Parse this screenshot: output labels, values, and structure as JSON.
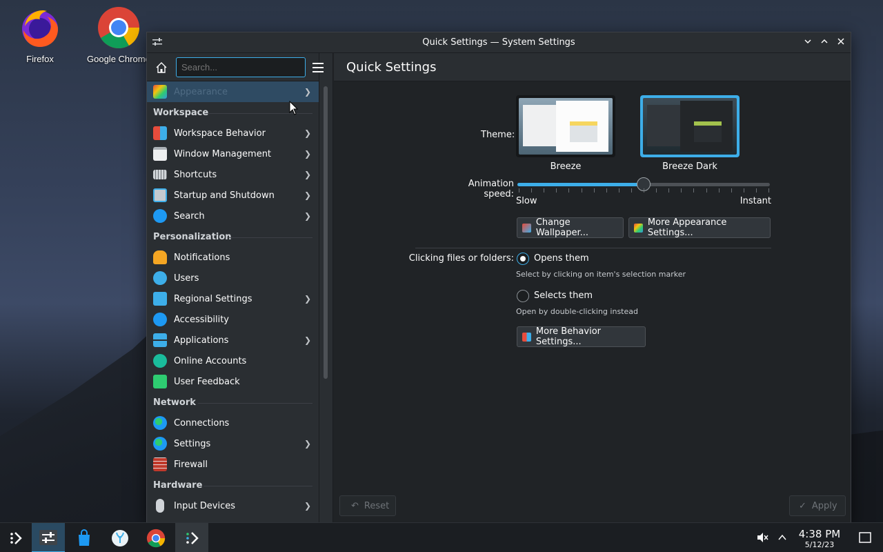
{
  "desktop": {
    "icons": [
      {
        "label": "Firefox"
      },
      {
        "label": "Google Chrome"
      }
    ]
  },
  "window": {
    "title": "Quick Settings — System Settings",
    "buttons": {
      "minimize": "⌄",
      "maximize": "⌃",
      "close": "✕"
    }
  },
  "sidebar": {
    "search_placeholder": "Search...",
    "selected_item": {
      "label": "Appearance"
    },
    "sections": [
      {
        "title": "Workspace",
        "items": [
          {
            "label": "Workspace Behavior",
            "has_arrow": true
          },
          {
            "label": "Window Management",
            "has_arrow": true
          },
          {
            "label": "Shortcuts",
            "has_arrow": true
          },
          {
            "label": "Startup and Shutdown",
            "has_arrow": true
          },
          {
            "label": "Search",
            "has_arrow": true
          }
        ]
      },
      {
        "title": "Personalization",
        "items": [
          {
            "label": "Notifications",
            "has_arrow": false
          },
          {
            "label": "Users",
            "has_arrow": false
          },
          {
            "label": "Regional Settings",
            "has_arrow": true
          },
          {
            "label": "Accessibility",
            "has_arrow": false
          },
          {
            "label": "Applications",
            "has_arrow": true
          },
          {
            "label": "Online Accounts",
            "has_arrow": false
          },
          {
            "label": "User Feedback",
            "has_arrow": false
          }
        ]
      },
      {
        "title": "Network",
        "items": [
          {
            "label": "Connections",
            "has_arrow": false
          },
          {
            "label": "Settings",
            "has_arrow": true
          },
          {
            "label": "Firewall",
            "has_arrow": false
          }
        ]
      },
      {
        "title": "Hardware",
        "items": [
          {
            "label": "Input Devices",
            "has_arrow": true
          }
        ]
      }
    ]
  },
  "main": {
    "heading": "Quick Settings",
    "theme_label": "Theme:",
    "themes": [
      {
        "name": "Breeze",
        "selected": false
      },
      {
        "name": "Breeze Dark",
        "selected": true
      }
    ],
    "animation_label": "Animation speed:",
    "animation_value_fraction": 0.5,
    "slow_label": "Slow",
    "instant_label": "Instant",
    "change_wallpaper_label": "Change Wallpaper...",
    "more_appearance_label": "More Appearance Settings...",
    "clicking_label": "Clicking files or folders:",
    "opens_label": "Opens them",
    "opens_hint": "Select by clicking on item's selection marker",
    "selects_label": "Selects them",
    "selects_hint": "Open by double-clicking instead",
    "selected_click_option": "Opens them",
    "more_behavior_label": "More Behavior Settings...",
    "reset_label": "Reset",
    "apply_label": "Apply"
  },
  "taskbar": {
    "time": "4:38 PM",
    "date": "5/12/23"
  },
  "colors": {
    "accent": "#3daee9",
    "window_bg": "#202326",
    "sidebar_bg": "#2a2e32",
    "selected_bg": "#2f4b63"
  }
}
